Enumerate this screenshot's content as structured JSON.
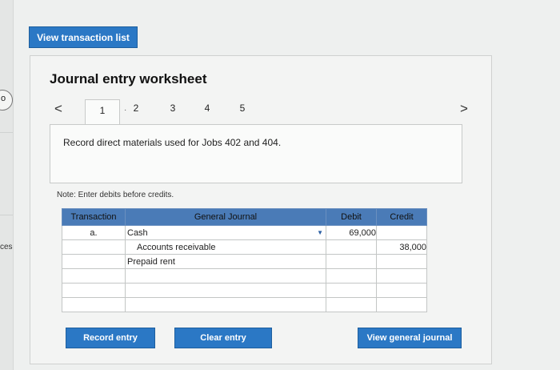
{
  "left_edge": {
    "circle_glyph": "o",
    "text": "ces"
  },
  "top_button": "View transaction list",
  "worksheet": {
    "title": "Journal entry worksheet",
    "nav": {
      "prev": "<",
      "next": ">"
    },
    "tabs": [
      "1",
      "2",
      "3",
      "4",
      "5"
    ],
    "active_tab": "1",
    "tab_marker": "·",
    "description": "Record direct materials used for Jobs 402 and 404.",
    "note": "Note: Enter debits before credits."
  },
  "journal": {
    "headers": {
      "transaction": "Transaction",
      "general_journal": "General Journal",
      "debit": "Debit",
      "credit": "Credit"
    },
    "rows": [
      {
        "transaction": "a.",
        "account": "Cash",
        "debit": "69,000",
        "credit": ""
      },
      {
        "transaction": "",
        "account": "Accounts receivable",
        "debit": "",
        "credit": "38,000"
      },
      {
        "transaction": "",
        "account": "Prepaid rent",
        "debit": "",
        "credit": ""
      },
      {
        "transaction": "",
        "account": "",
        "debit": "",
        "credit": ""
      },
      {
        "transaction": "",
        "account": "",
        "debit": "",
        "credit": ""
      },
      {
        "transaction": "",
        "account": "",
        "debit": "",
        "credit": ""
      }
    ]
  },
  "buttons": {
    "record": "Record entry",
    "clear": "Clear entry",
    "view_general_journal": "View general journal"
  },
  "colors": {
    "accent_blue": "#2b78c5",
    "header_blue": "#4a7bb7"
  }
}
